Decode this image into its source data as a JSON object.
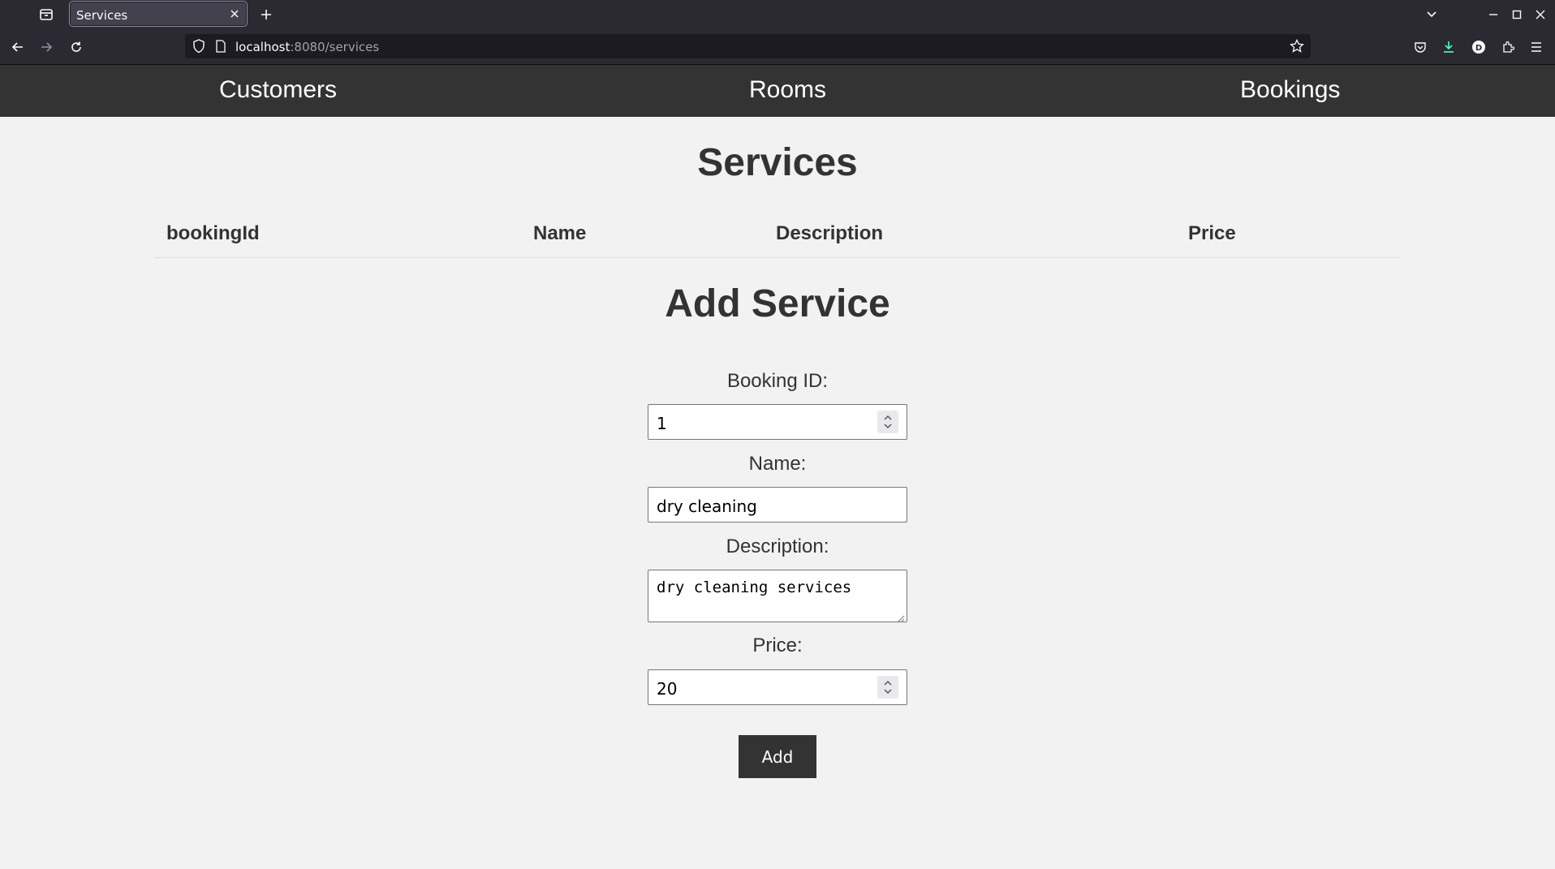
{
  "browser": {
    "tab_title": "Services",
    "url_host": "localhost",
    "url_path": ":8080/services"
  },
  "nav": {
    "items": [
      {
        "label": "Customers"
      },
      {
        "label": "Rooms"
      },
      {
        "label": "Bookings"
      }
    ]
  },
  "page": {
    "title": "Services",
    "table": {
      "columns": [
        "bookingId",
        "Name",
        "Description",
        "Price"
      ],
      "rows": []
    }
  },
  "form": {
    "title": "Add Service",
    "booking_id_label": "Booking ID:",
    "booking_id_value": "1",
    "name_label": "Name:",
    "name_value": "dry cleaning",
    "description_label": "Description:",
    "description_value": "dry cleaning services",
    "price_label": "Price:",
    "price_value": "20",
    "submit_label": "Add"
  },
  "colors": {
    "nav_bg": "#333333",
    "page_bg": "#f2f2f2",
    "button_bg": "#333333"
  }
}
